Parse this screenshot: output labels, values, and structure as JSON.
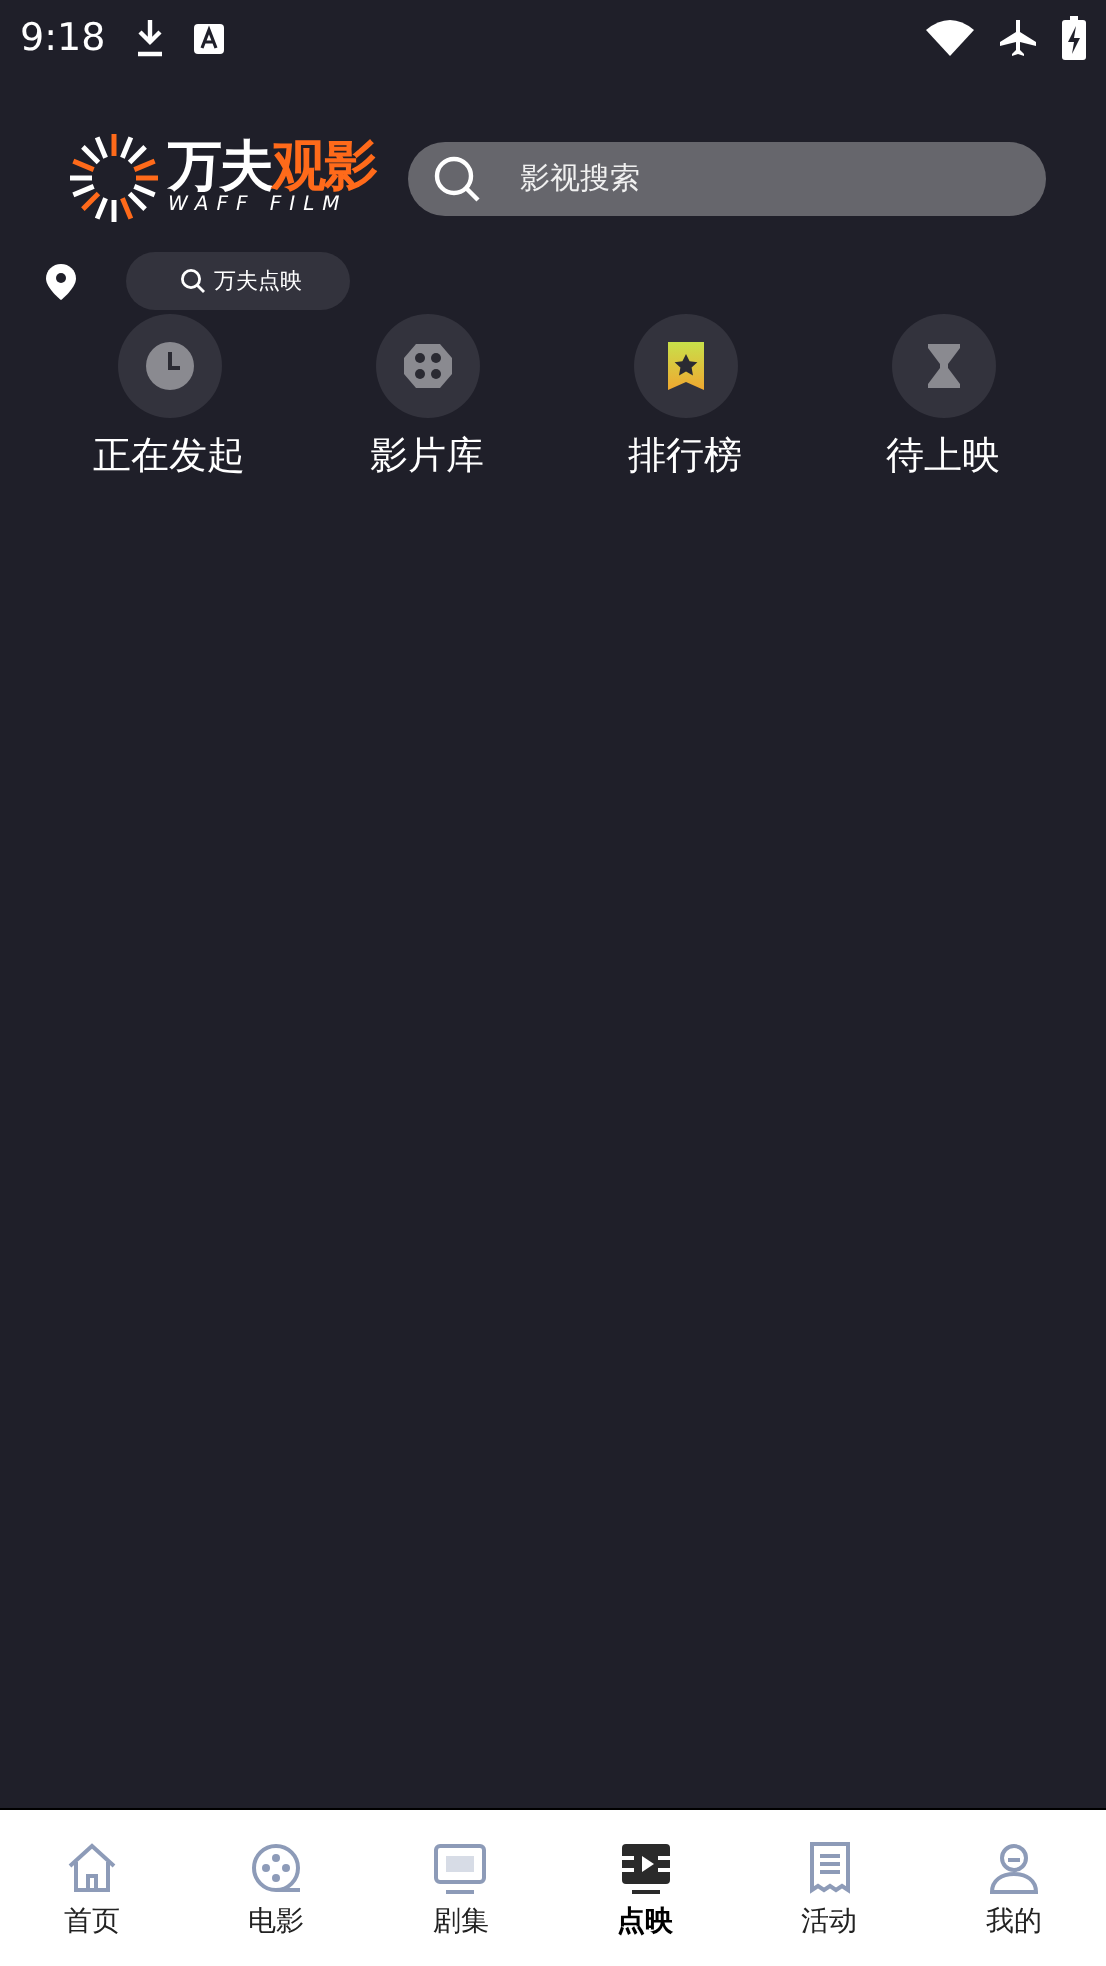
{
  "status_bar": {
    "time": "9:18"
  },
  "header": {
    "logo": {
      "title_white": "万夫",
      "title_accent": "观影",
      "subtitle": "WAFF FILM"
    },
    "search": {
      "placeholder": "影视搜索"
    }
  },
  "location_row": {
    "chip": "万夫点映"
  },
  "shortcuts": [
    {
      "label": "正在发起",
      "kind": "clock"
    },
    {
      "label": "影片库",
      "kind": "reel"
    },
    {
      "label": "排行榜",
      "kind": "ribbon"
    },
    {
      "label": "待上映",
      "kind": "hourglass"
    }
  ],
  "tab_bar": [
    {
      "label": "首页",
      "kind": "home",
      "selected": false
    },
    {
      "label": "电影",
      "kind": "film",
      "selected": false
    },
    {
      "label": "剧集",
      "kind": "tv",
      "selected": false
    },
    {
      "label": "点映",
      "kind": "screening",
      "selected": true
    },
    {
      "label": "活动",
      "kind": "receipt",
      "selected": false
    },
    {
      "label": "我的",
      "kind": "user",
      "selected": false
    }
  ]
}
